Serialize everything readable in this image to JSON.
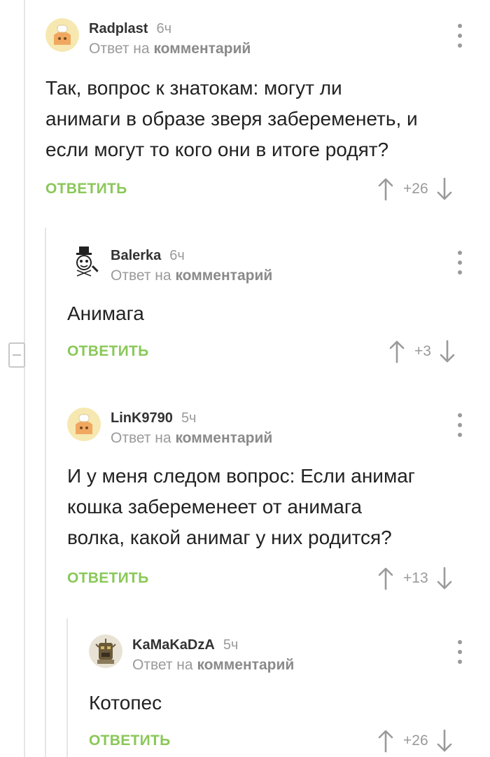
{
  "comments": [
    {
      "username": "Radplast",
      "time": "6ч",
      "reply_prefix": "Ответ на",
      "reply_target": "комментарий",
      "text": "Так, вопрос к знатокам: могут ли\nанимаги в образе зверя забеременеть, и\nесли могут то кого они в итоге родят?",
      "reply_label": "ОТВЕТИТЬ",
      "score": "+26",
      "avatar_icon": "default-avatar-icon"
    },
    {
      "username": "Balerka",
      "time": "6ч",
      "reply_prefix": "Ответ на",
      "reply_target": "комментарий",
      "text": "Анимага",
      "reply_label": "ОТВЕТИТЬ",
      "score": "+3",
      "avatar_icon": "top-hat-character-avatar"
    },
    {
      "username": "LinK9790",
      "time": "5ч",
      "reply_prefix": "Ответ на",
      "reply_target": "комментарий",
      "text": "И у меня следом вопрос: Если анимаг\nкошка забеременеет от анимага\nволка, какой анимаг у них родится?",
      "reply_label": "ОТВЕТИТЬ",
      "score": "+13",
      "avatar_icon": "default-avatar-icon"
    },
    {
      "username": "KaMaKaDzA",
      "time": "5ч",
      "reply_prefix": "Ответ на",
      "reply_target": "комментарий",
      "text": "Котопес",
      "reply_label": "ОТВЕТИТЬ",
      "score": "+26",
      "avatar_icon": "robot-avatar"
    }
  ],
  "icons": {
    "upvote": "arrow-up-icon",
    "downvote": "arrow-down-icon",
    "menu": "more-vertical-icon",
    "collapse": "minus-icon"
  },
  "colors": {
    "reply_green": "#8ac858",
    "meta_gray": "#9a9a9a",
    "thread_line": "#e6e6e6",
    "default_avatar_bg": "#f6e8b0"
  }
}
